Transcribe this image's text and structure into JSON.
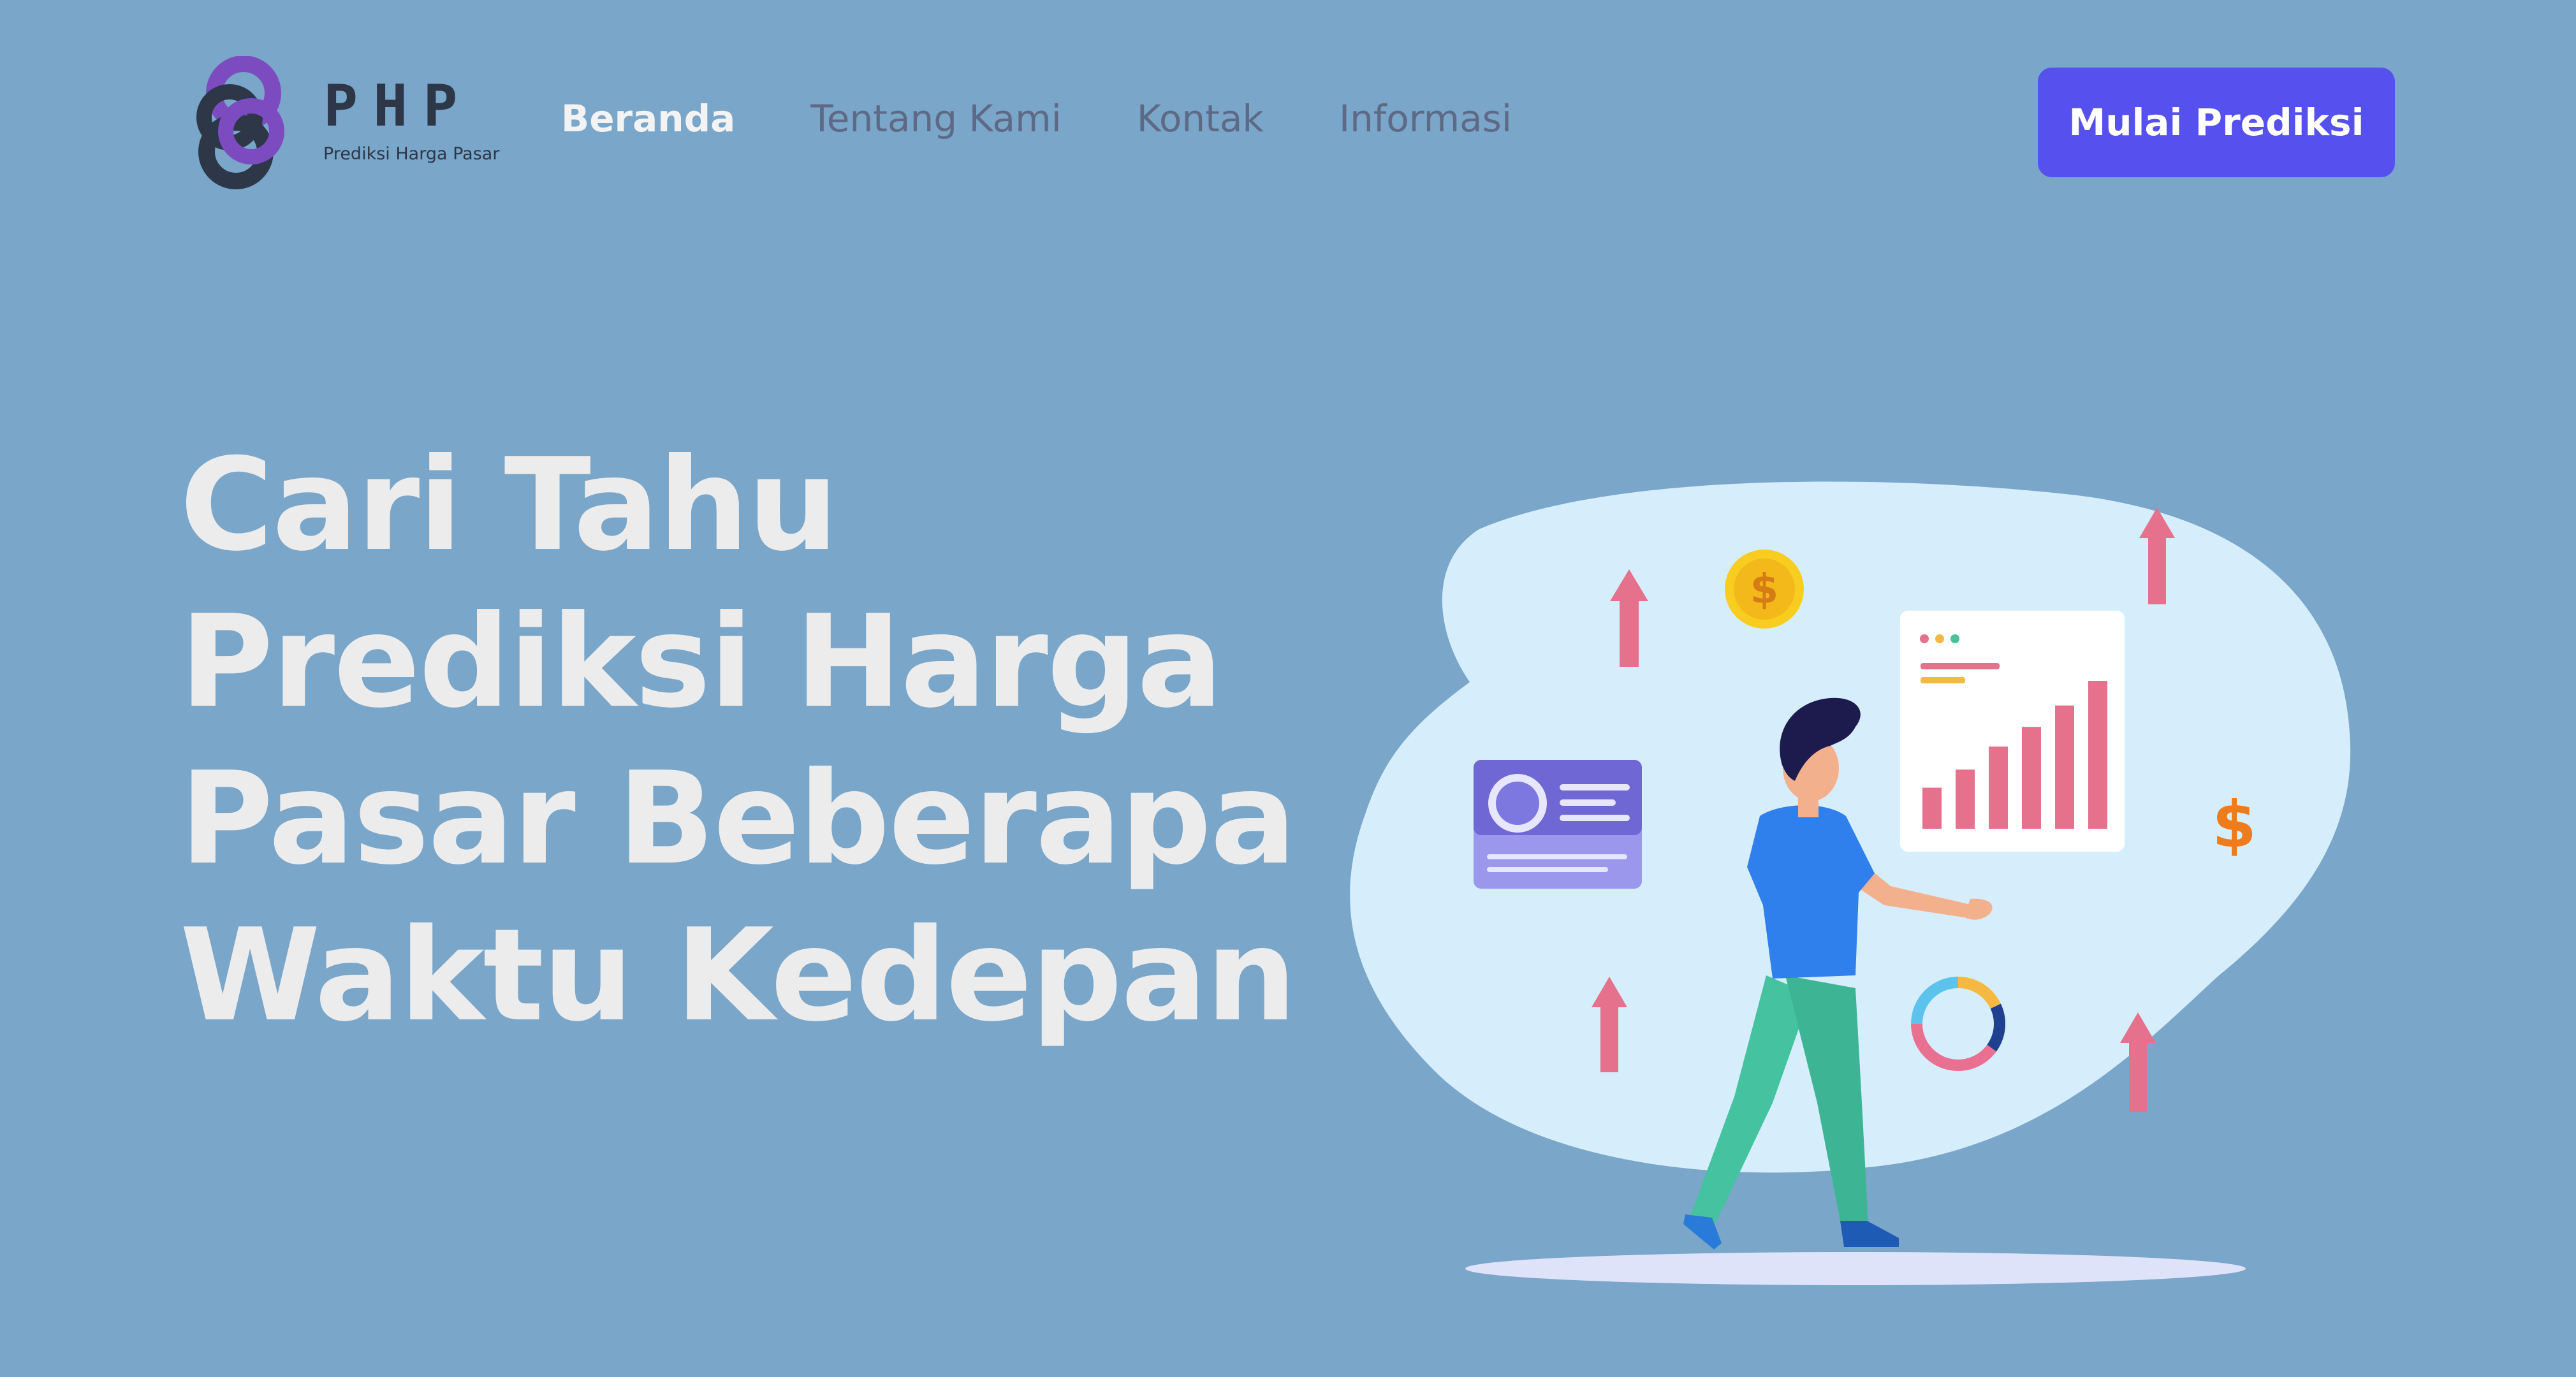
{
  "brand": {
    "title": "PHP",
    "subtitle": "Prediksi Harga Pasar"
  },
  "nav": {
    "items": [
      {
        "label": "Beranda",
        "active": true
      },
      {
        "label": "Tentang Kami",
        "active": false
      },
      {
        "label": "Kontak",
        "active": false
      },
      {
        "label": "Informasi",
        "active": false
      }
    ]
  },
  "cta": {
    "label": "Mulai Prediksi"
  },
  "hero": {
    "lines": [
      "Cari Tahu",
      "Prediksi Harga",
      "Pasar Beberapa",
      "Waktu Kedepan"
    ]
  },
  "illustration": {
    "coin_symbol": "$",
    "dollar_symbol": "$",
    "bar_chart_values": [
      25,
      36,
      50,
      62,
      75,
      90
    ],
    "donut_segments": [
      {
        "name": "orange",
        "value": 0.18,
        "color": "#f5b942"
      },
      {
        "name": "navy",
        "value": 0.17,
        "color": "#1f3f8f"
      },
      {
        "name": "pink",
        "value": 0.4,
        "color": "#e97090"
      },
      {
        "name": "cyan",
        "value": 0.25,
        "color": "#5cc3ec"
      }
    ]
  },
  "colors": {
    "background": "#79a6c9",
    "accent": "#5550ee",
    "headline": "#ececec",
    "nav_inactive": "#5e6a85"
  }
}
